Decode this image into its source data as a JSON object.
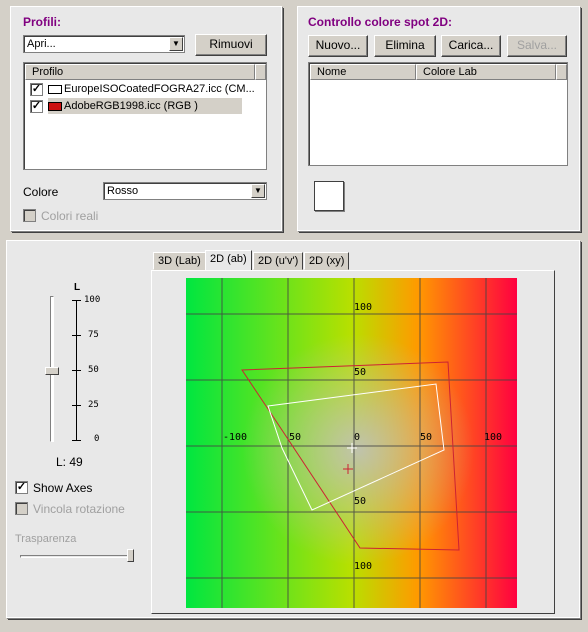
{
  "profiles": {
    "title": "Profili:",
    "combo_value": "Apri...",
    "remove_label": "Rimuovi",
    "column_header": "Profilo",
    "items": [
      {
        "label": "EuropeISOCoatedFOGRA27.icc (CM...",
        "checked": true,
        "swatch": "#ffffff"
      },
      {
        "label": "AdobeRGB1998.icc (RGB )",
        "checked": true,
        "swatch": "#cc1111"
      }
    ],
    "color_label": "Colore",
    "color_value": "Rosso",
    "real_colors_label": "Colori reali"
  },
  "spot": {
    "title": "Controllo colore spot 2D:",
    "new_label": "Nuovo...",
    "delete_label": "Elimina",
    "load_label": "Carica...",
    "save_label": "Salva...",
    "col_name": "Nome",
    "col_lab": "Colore Lab"
  },
  "view": {
    "slider_title": "L",
    "l_ticks": [
      "100",
      "75",
      "50",
      "25",
      "0"
    ],
    "l_value": "L: 49",
    "show_axes_label": "Show Axes",
    "lock_rotation_label": "Vincola rotazione",
    "transparency_label": "Trasparenza",
    "tabs": [
      "3D (Lab)",
      "2D (ab)",
      "2D (u'v')",
      "2D (xy)"
    ],
    "active_tab": 1
  },
  "plot": {
    "axis_labels": {
      "top": "100",
      "upper": "50",
      "left": "-100",
      "left_inner": "50",
      "center": "0",
      "right_inner": "50",
      "right": "100",
      "lower": "50",
      "bottom": "100"
    }
  },
  "colors": {
    "accent_title": "#800080",
    "gamut_red": "#cc2233",
    "gamut_white": "#ffffff"
  }
}
